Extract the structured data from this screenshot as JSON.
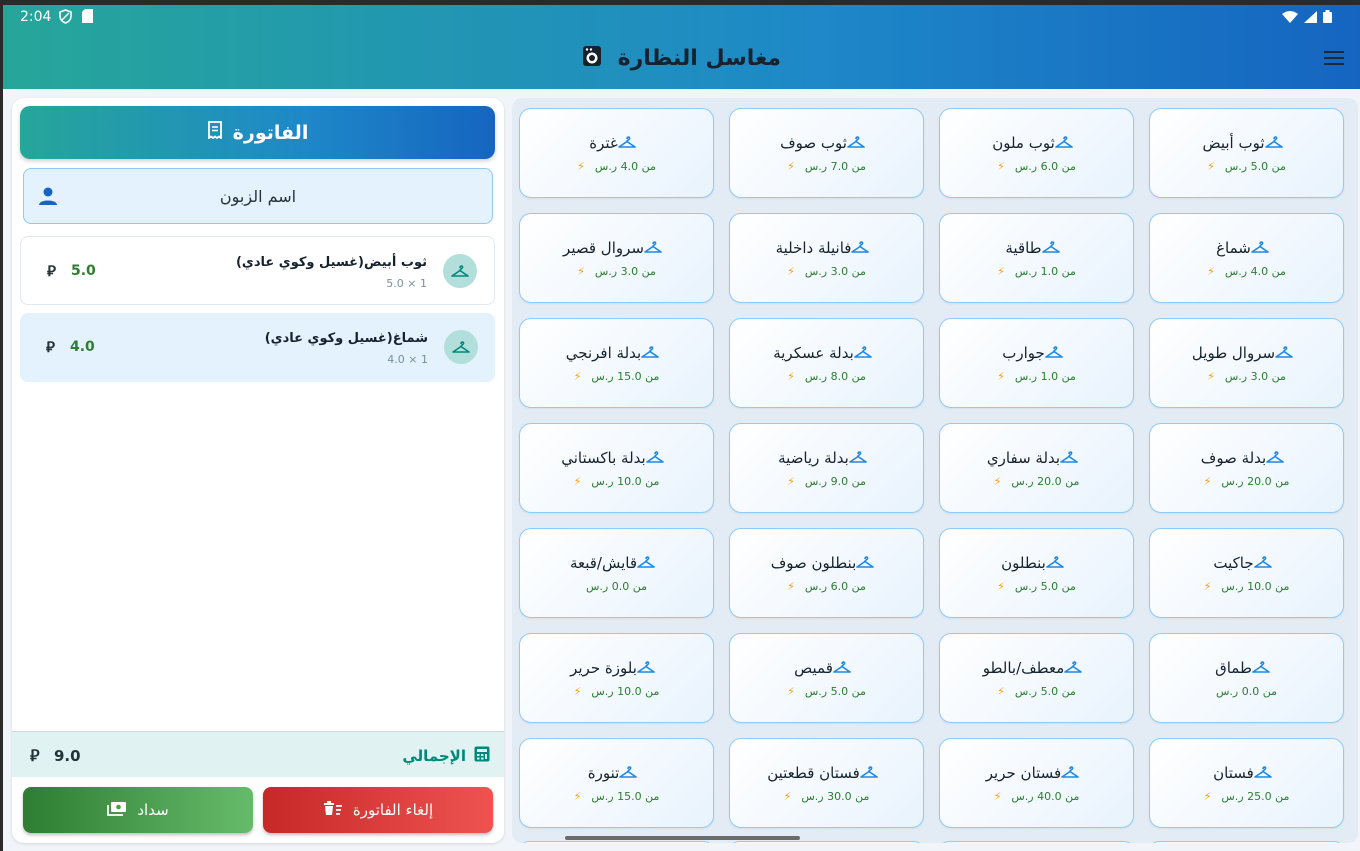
{
  "status": {
    "time": "2:04"
  },
  "app": {
    "title": "مغاسل النظارة"
  },
  "invoice": {
    "header": "الفاتورة",
    "customer_placeholder": "اسم الزبون",
    "items": [
      {
        "name": "ثوب أبيض(غسيل وكوي عادي)",
        "qty": "5.0 × 1",
        "price": "5.0"
      },
      {
        "name": "شماغ(غسيل وكوي عادي)",
        "qty": "4.0 × 1",
        "price": "4.0"
      }
    ],
    "total_label": "الإجمالي",
    "total_value": "9.0",
    "currency_symbol": "⃁",
    "pay_label": "سداد",
    "cancel_label": "إلغاء الفاتورة"
  },
  "products": [
    {
      "name": "ثوب أبيض",
      "price": "من 5.0 ر.س",
      "bolt": true
    },
    {
      "name": "ثوب ملون",
      "price": "من 6.0 ر.س",
      "bolt": true
    },
    {
      "name": "ثوب صوف",
      "price": "من 7.0 ر.س",
      "bolt": true
    },
    {
      "name": "غترة",
      "price": "من 4.0 ر.س",
      "bolt": true
    },
    {
      "name": "شماغ",
      "price": "من 4.0 ر.س",
      "bolt": true
    },
    {
      "name": "طاقية",
      "price": "من 1.0 ر.س",
      "bolt": true
    },
    {
      "name": "فانيلة داخلية",
      "price": "من 3.0 ر.س",
      "bolt": true
    },
    {
      "name": "سروال قصير",
      "price": "من 3.0 ر.س",
      "bolt": true
    },
    {
      "name": "سروال طويل",
      "price": "من 3.0 ر.س",
      "bolt": true
    },
    {
      "name": "جوارب",
      "price": "من 1.0 ر.س",
      "bolt": true
    },
    {
      "name": "بدلة عسكرية",
      "price": "من 8.0 ر.س",
      "bolt": true
    },
    {
      "name": "بدلة افرنجي",
      "price": "من 15.0 ر.س",
      "bolt": true
    },
    {
      "name": "بدلة صوف",
      "price": "من 20.0 ر.س",
      "bolt": true
    },
    {
      "name": "بدلة سفاري",
      "price": "من 20.0 ر.س",
      "bolt": true
    },
    {
      "name": "بدلة رياضية",
      "price": "من 9.0 ر.س",
      "bolt": true
    },
    {
      "name": "بدلة باكستاني",
      "price": "من 10.0 ر.س",
      "bolt": true
    },
    {
      "name": "جاكيت",
      "price": "من 10.0 ر.س",
      "bolt": true
    },
    {
      "name": "بنطلون",
      "price": "من 5.0 ر.س",
      "bolt": true
    },
    {
      "name": "بنطلون صوف",
      "price": "من 6.0 ر.س",
      "bolt": true
    },
    {
      "name": "قايش/قبعة",
      "price": "من 0.0 ر.س",
      "bolt": false
    },
    {
      "name": "طماق",
      "price": "من 0.0 ر.س",
      "bolt": false
    },
    {
      "name": "معطف/بالطو",
      "price": "من 5.0 ر.س",
      "bolt": true
    },
    {
      "name": "قميص",
      "price": "من 5.0 ر.س",
      "bolt": true
    },
    {
      "name": "بلوزة حرير",
      "price": "من 10.0 ر.س",
      "bolt": true
    },
    {
      "name": "فستان",
      "price": "من 25.0 ر.س",
      "bolt": true
    },
    {
      "name": "فستان حرير",
      "price": "من 40.0 ر.س",
      "bolt": true
    },
    {
      "name": "فستان قطعتين",
      "price": "من 30.0 ر.س",
      "bolt": true
    },
    {
      "name": "تنورة",
      "price": "من 15.0 ر.س",
      "bolt": true
    }
  ],
  "colors": {
    "accent_teal": "#26a69a",
    "accent_blue": "#1565c0",
    "price_green": "#2e7d32",
    "bolt_orange": "#f59e0b"
  }
}
